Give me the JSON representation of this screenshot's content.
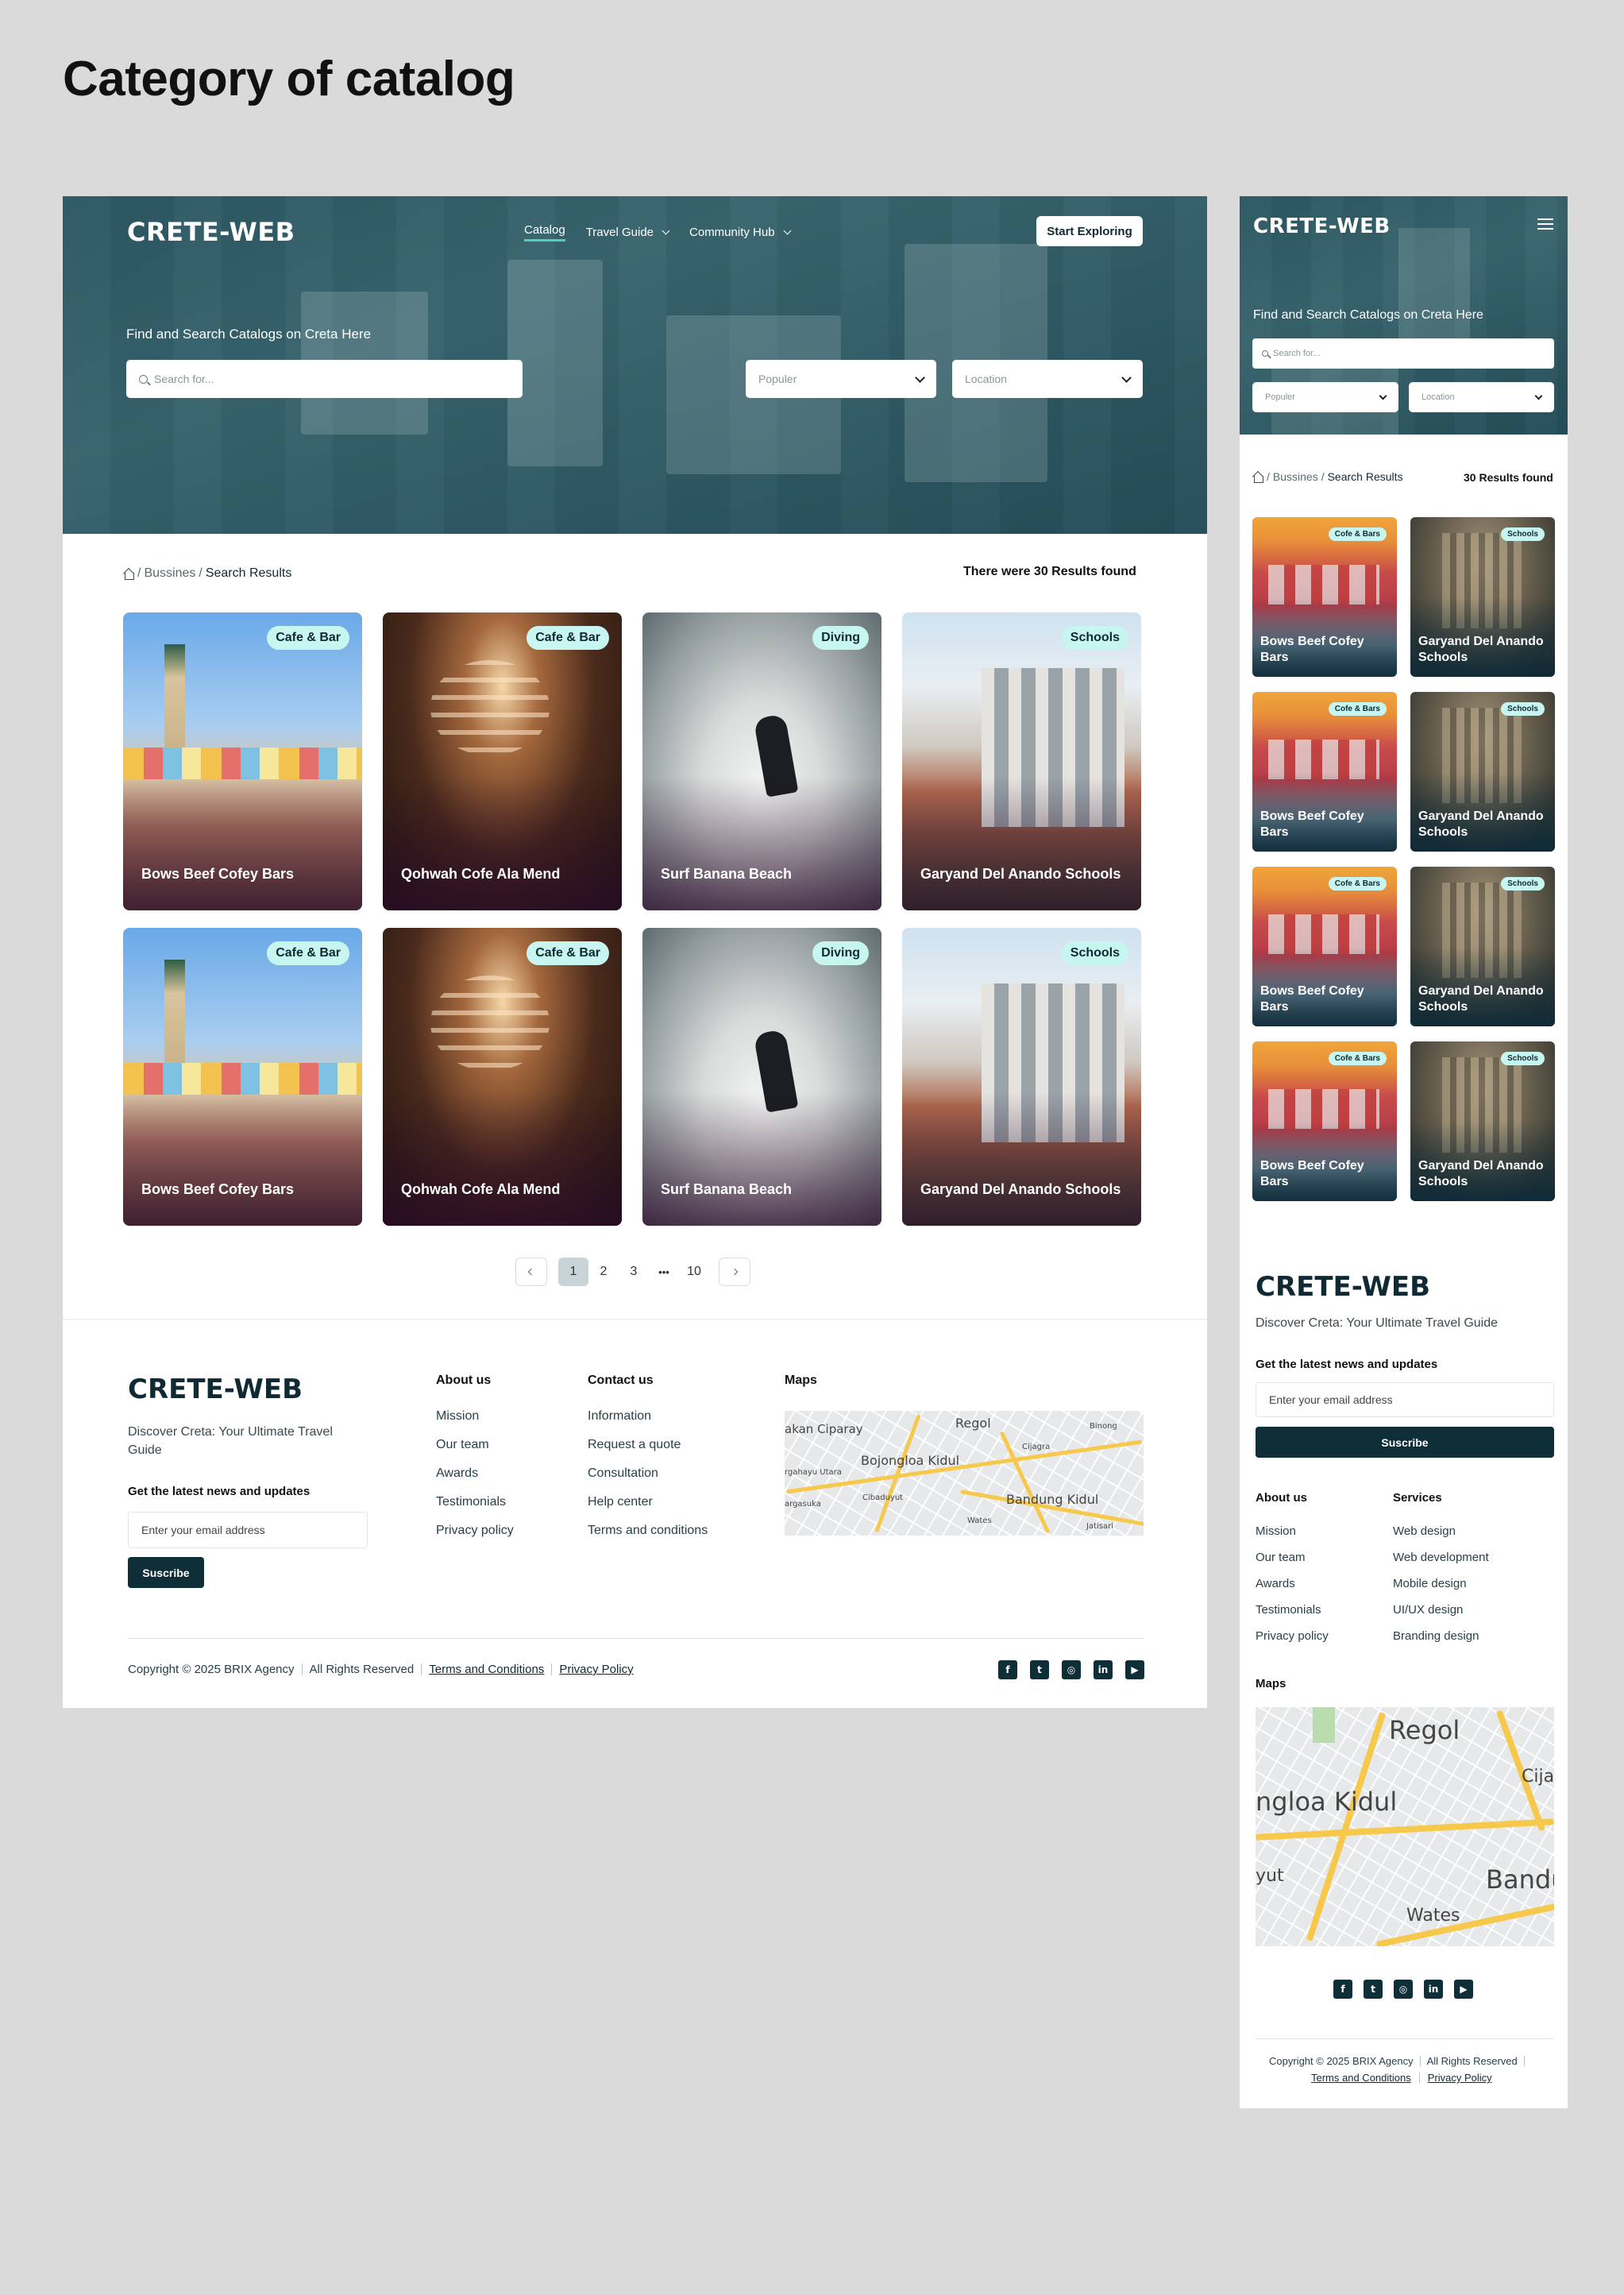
{
  "page_title": "Category of catalog",
  "brand": "CRETE-WEB",
  "nav": {
    "items": [
      {
        "label": "Catalog"
      },
      {
        "label": "Travel Guide"
      },
      {
        "label": "Community Hub"
      }
    ],
    "cta": "Start Exploring"
  },
  "hero": {
    "heading": "Find and Search Catalogs on Creta Here",
    "search_placeholder": "Search for...",
    "filter_popular": "Populer",
    "filter_location": "Location"
  },
  "breadcrumb": {
    "parent": "Bussines",
    "sep": "/",
    "current": "Search Results"
  },
  "results": {
    "desktop_text": "There were 30 Results found",
    "mobile_text": "30 Results found"
  },
  "desktop_cards": [
    {
      "tag": "Cafe & Bar",
      "title": "Bows Beef Cofey Bars"
    },
    {
      "tag": "Cafe & Bar",
      "title": "Qohwah Cofe Ala Mend"
    },
    {
      "tag": "Diving",
      "title": "Surf Banana Beach"
    },
    {
      "tag": "Schools",
      "title": "Garyand Del Anando Schools"
    },
    {
      "tag": "Cafe & Bar",
      "title": "Bows Beef Cofey Bars"
    },
    {
      "tag": "Cafe & Bar",
      "title": "Qohwah Cofe Ala Mend"
    },
    {
      "tag": "Diving",
      "title": "Surf Banana Beach"
    },
    {
      "tag": "Schools",
      "title": "Garyand Del Anando Schools"
    }
  ],
  "mobile_cards": [
    {
      "tag": "Cofe & Bars",
      "title": "Bows Beef Cofey Bars"
    },
    {
      "tag": "Schools",
      "title": "Garyand Del Anando Schools"
    },
    {
      "tag": "Cofe & Bars",
      "title": "Bows Beef Cofey Bars"
    },
    {
      "tag": "Schools",
      "title": "Garyand Del Anando Schools"
    },
    {
      "tag": "Cofe & Bars",
      "title": "Bows Beef Cofey Bars"
    },
    {
      "tag": "Schools",
      "title": "Garyand Del Anando Schools"
    },
    {
      "tag": "Cofe & Bars",
      "title": "Bows Beef Cofey Bars"
    },
    {
      "tag": "Schools",
      "title": "Garyand Del Anando Schools"
    }
  ],
  "pagination": {
    "pages": [
      "1",
      "2",
      "3",
      "10"
    ],
    "ellipsis": "•••",
    "current": "1"
  },
  "footer": {
    "tagline": "Discover Creta: Your Ultimate Travel Guide",
    "newsletter_heading": "Get the latest news and updates",
    "email_placeholder": "Enter your email address",
    "subscribe": "Suscribe",
    "about": {
      "heading": "About us",
      "links": [
        "Mission",
        "Our team",
        "Awards",
        "Testimonials",
        "Privacy policy"
      ]
    },
    "contact": {
      "heading": "Contact us",
      "links": [
        "Information",
        "Request a quote",
        "Consultation",
        "Help center",
        "Terms and conditions"
      ]
    },
    "services": {
      "heading": "Services",
      "links": [
        "Web design",
        "Web development",
        "Mobile design",
        "UI/UX design",
        "Branding design"
      ]
    },
    "maps_heading": "Maps",
    "map_labels_desktop": [
      "akan Ciparay",
      "Regol",
      "Binong",
      "Bojongloa Kidul",
      "Cijagra",
      "rgahayu Utara",
      "Cibaduyut",
      "argasuka",
      "Bandung Kidul",
      "Wates",
      "Jatisari"
    ],
    "map_labels_mobile": [
      "Regol",
      "ngloa Kidul",
      "Cijag",
      "yut",
      "Bandu",
      "Wates"
    ],
    "copyright": "Copyright © 2025 BRIX Agency",
    "rights": "All Rights Reserved",
    "terms": "Terms and Conditions",
    "privacy": "Privacy Policy",
    "social": [
      {
        "icon": "facebook-icon",
        "glyph": "f"
      },
      {
        "icon": "twitter-icon",
        "glyph": "t"
      },
      {
        "icon": "instagram-icon",
        "glyph": "◎"
      },
      {
        "icon": "linkedin-icon",
        "glyph": "in"
      },
      {
        "icon": "youtube-icon",
        "glyph": "▶"
      }
    ]
  },
  "colors": {
    "primary": "#0f2f38",
    "accent": "#4fd1b8",
    "tag_bg": "#c7f5ef",
    "page_bg": "#dadada"
  }
}
